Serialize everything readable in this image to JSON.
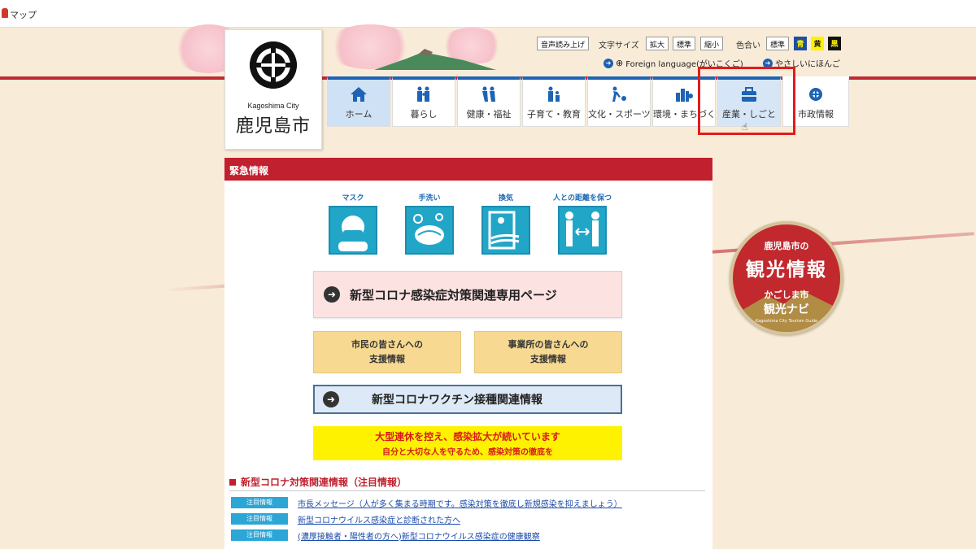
{
  "browser": {
    "tab_title": "マップ"
  },
  "logo": {
    "en": "Kagoshima City",
    "jp": "鹿児島市"
  },
  "utility": {
    "voice": "音声読み上げ",
    "text_size_label": "文字サイズ",
    "size_up": "拡大",
    "size_std": "標準",
    "size_down": "縮小",
    "color_label": "色合い",
    "color_std": "標準",
    "color_blue": "青",
    "color_yellow": "黄",
    "color_black": "黒",
    "foreign": "Foreign language(がいこくご)",
    "easy_jp": "やさしいにほんご"
  },
  "nav": [
    {
      "label": "ホーム",
      "icon": "home-icon"
    },
    {
      "label": "暮らし",
      "icon": "family-icon"
    },
    {
      "label": "健康・福祉",
      "icon": "walking-assist-icon"
    },
    {
      "label": "子育て・教育",
      "icon": "parent-child-icon"
    },
    {
      "label": "文化・スポーツ",
      "icon": "sports-icon"
    },
    {
      "label": "環境・まちづくり",
      "icon": "city-icon"
    },
    {
      "label": "産業・しごと",
      "icon": "briefcase-icon"
    },
    {
      "label": "市政情報",
      "icon": "city-emblem-icon"
    }
  ],
  "urgent": {
    "title": "緊急情報"
  },
  "pictograms": [
    {
      "caption": "マスク"
    },
    {
      "caption": "手洗い"
    },
    {
      "caption": "換気"
    },
    {
      "caption": "人との距離を保つ"
    }
  ],
  "corona_page": {
    "label": "新型コロナ感染症対策関連専用ページ"
  },
  "support": {
    "citizens_1": "市民の皆さんへの",
    "citizens_2": "支援情報",
    "business_1": "事業所の皆さんへの",
    "business_2": "支援情報"
  },
  "vaccine": {
    "label": "新型コロナワクチン接種関連情報"
  },
  "notice": {
    "line1": "大型連休を控え、感染拡大が続いています",
    "line2": "自分と大切な人を守るため、感染対策の徹底を"
  },
  "section": {
    "title": "新型コロナ対策関連情報（注目情報）"
  },
  "news": [
    {
      "badge": "注目情報",
      "text": "市長メッセージ（人が多く集まる時期です。感染対策を徹底し新規感染を抑えましょう）"
    },
    {
      "badge": "注目情報",
      "text": "新型コロナウイルス感染症と診断された方へ"
    },
    {
      "badge": "注目情報",
      "text": "(濃厚接触者・陽性者の方へ)新型コロナウイルス感染症の健康観察"
    }
  ],
  "tourism": {
    "line1": "鹿児島市の",
    "line2": "観光情報",
    "line3": "かごしま市",
    "line4": "観光ナビ",
    "line5": "Kagoshima City Tourism Guide"
  },
  "colors": {
    "accent_red": "#c1202e",
    "nav_blue": "#1e63b5",
    "highlight": "#e31b1b"
  }
}
